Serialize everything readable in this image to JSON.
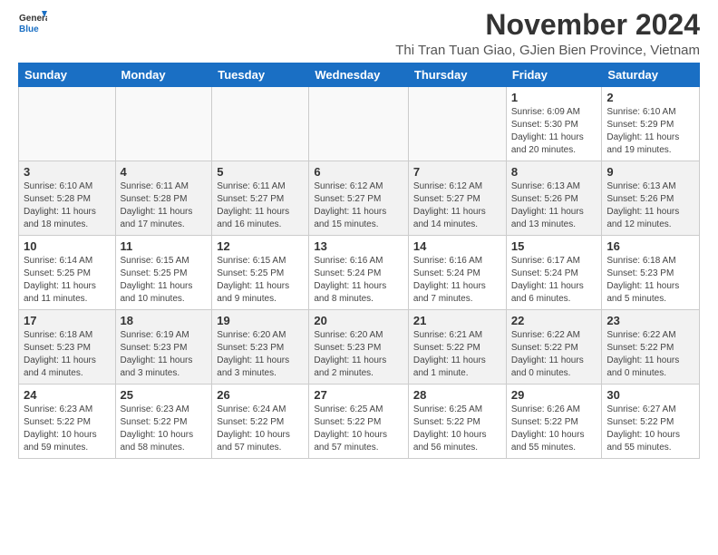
{
  "header": {
    "logo_general": "General",
    "logo_blue": "Blue",
    "month_title": "November 2024",
    "subtitle": "Thi Tran Tuan Giao, GJien Bien Province, Vietnam"
  },
  "weekdays": [
    "Sunday",
    "Monday",
    "Tuesday",
    "Wednesday",
    "Thursday",
    "Friday",
    "Saturday"
  ],
  "weeks": [
    [
      {
        "day": "",
        "info": "",
        "empty": true
      },
      {
        "day": "",
        "info": "",
        "empty": true
      },
      {
        "day": "",
        "info": "",
        "empty": true
      },
      {
        "day": "",
        "info": "",
        "empty": true
      },
      {
        "day": "",
        "info": "",
        "empty": true
      },
      {
        "day": "1",
        "info": "Sunrise: 6:09 AM\nSunset: 5:30 PM\nDaylight: 11 hours and 20 minutes."
      },
      {
        "day": "2",
        "info": "Sunrise: 6:10 AM\nSunset: 5:29 PM\nDaylight: 11 hours and 19 minutes."
      }
    ],
    [
      {
        "day": "3",
        "info": "Sunrise: 6:10 AM\nSunset: 5:28 PM\nDaylight: 11 hours and 18 minutes."
      },
      {
        "day": "4",
        "info": "Sunrise: 6:11 AM\nSunset: 5:28 PM\nDaylight: 11 hours and 17 minutes."
      },
      {
        "day": "5",
        "info": "Sunrise: 6:11 AM\nSunset: 5:27 PM\nDaylight: 11 hours and 16 minutes."
      },
      {
        "day": "6",
        "info": "Sunrise: 6:12 AM\nSunset: 5:27 PM\nDaylight: 11 hours and 15 minutes."
      },
      {
        "day": "7",
        "info": "Sunrise: 6:12 AM\nSunset: 5:27 PM\nDaylight: 11 hours and 14 minutes."
      },
      {
        "day": "8",
        "info": "Sunrise: 6:13 AM\nSunset: 5:26 PM\nDaylight: 11 hours and 13 minutes."
      },
      {
        "day": "9",
        "info": "Sunrise: 6:13 AM\nSunset: 5:26 PM\nDaylight: 11 hours and 12 minutes."
      }
    ],
    [
      {
        "day": "10",
        "info": "Sunrise: 6:14 AM\nSunset: 5:25 PM\nDaylight: 11 hours and 11 minutes."
      },
      {
        "day": "11",
        "info": "Sunrise: 6:15 AM\nSunset: 5:25 PM\nDaylight: 11 hours and 10 minutes."
      },
      {
        "day": "12",
        "info": "Sunrise: 6:15 AM\nSunset: 5:25 PM\nDaylight: 11 hours and 9 minutes."
      },
      {
        "day": "13",
        "info": "Sunrise: 6:16 AM\nSunset: 5:24 PM\nDaylight: 11 hours and 8 minutes."
      },
      {
        "day": "14",
        "info": "Sunrise: 6:16 AM\nSunset: 5:24 PM\nDaylight: 11 hours and 7 minutes."
      },
      {
        "day": "15",
        "info": "Sunrise: 6:17 AM\nSunset: 5:24 PM\nDaylight: 11 hours and 6 minutes."
      },
      {
        "day": "16",
        "info": "Sunrise: 6:18 AM\nSunset: 5:23 PM\nDaylight: 11 hours and 5 minutes."
      }
    ],
    [
      {
        "day": "17",
        "info": "Sunrise: 6:18 AM\nSunset: 5:23 PM\nDaylight: 11 hours and 4 minutes."
      },
      {
        "day": "18",
        "info": "Sunrise: 6:19 AM\nSunset: 5:23 PM\nDaylight: 11 hours and 3 minutes."
      },
      {
        "day": "19",
        "info": "Sunrise: 6:20 AM\nSunset: 5:23 PM\nDaylight: 11 hours and 3 minutes."
      },
      {
        "day": "20",
        "info": "Sunrise: 6:20 AM\nSunset: 5:23 PM\nDaylight: 11 hours and 2 minutes."
      },
      {
        "day": "21",
        "info": "Sunrise: 6:21 AM\nSunset: 5:22 PM\nDaylight: 11 hours and 1 minute."
      },
      {
        "day": "22",
        "info": "Sunrise: 6:22 AM\nSunset: 5:22 PM\nDaylight: 11 hours and 0 minutes."
      },
      {
        "day": "23",
        "info": "Sunrise: 6:22 AM\nSunset: 5:22 PM\nDaylight: 11 hours and 0 minutes."
      }
    ],
    [
      {
        "day": "24",
        "info": "Sunrise: 6:23 AM\nSunset: 5:22 PM\nDaylight: 10 hours and 59 minutes."
      },
      {
        "day": "25",
        "info": "Sunrise: 6:23 AM\nSunset: 5:22 PM\nDaylight: 10 hours and 58 minutes."
      },
      {
        "day": "26",
        "info": "Sunrise: 6:24 AM\nSunset: 5:22 PM\nDaylight: 10 hours and 57 minutes."
      },
      {
        "day": "27",
        "info": "Sunrise: 6:25 AM\nSunset: 5:22 PM\nDaylight: 10 hours and 57 minutes."
      },
      {
        "day": "28",
        "info": "Sunrise: 6:25 AM\nSunset: 5:22 PM\nDaylight: 10 hours and 56 minutes."
      },
      {
        "day": "29",
        "info": "Sunrise: 6:26 AM\nSunset: 5:22 PM\nDaylight: 10 hours and 55 minutes."
      },
      {
        "day": "30",
        "info": "Sunrise: 6:27 AM\nSunset: 5:22 PM\nDaylight: 10 hours and 55 minutes."
      }
    ]
  ],
  "colors": {
    "header_bg": "#1a6fc4",
    "alt_row_bg": "#f2f2f2",
    "empty_bg": "#f9f9f9"
  }
}
